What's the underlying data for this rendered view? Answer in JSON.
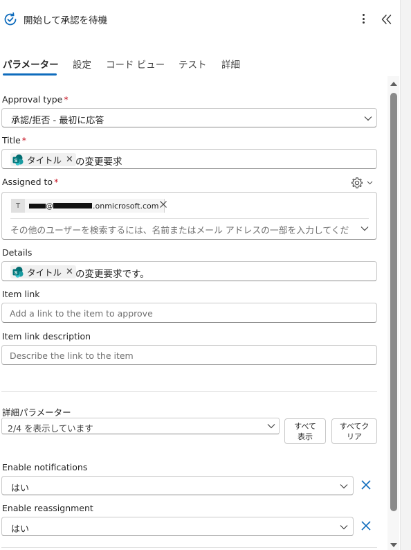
{
  "header": {
    "title": "開始して承認を待機",
    "icon": "approval-refresh-icon",
    "accent": "#0f6cbd"
  },
  "tabs": [
    {
      "label": "パラメーター",
      "active": true
    },
    {
      "label": "設定",
      "active": false
    },
    {
      "label": "コード ビュー",
      "active": false
    },
    {
      "label": "テスト",
      "active": false
    },
    {
      "label": "詳細",
      "active": false
    }
  ],
  "fields": {
    "approval_type": {
      "label": "Approval type",
      "required": "*",
      "value": "承認/拒否 - 最初に応答"
    },
    "title": {
      "label": "Title",
      "required": "*",
      "token": "タイトル",
      "token_close": "✕",
      "suffix": "の変更要求"
    },
    "assigned_to": {
      "label": "Assigned to",
      "required": "*",
      "avatar_initial": "T",
      "email_at": "@",
      "email_domain": ".onmicrosoft.com",
      "placeholder": "その他のユーザーを検索するには、名前またはメール アドレスの一部を入力してくだ"
    },
    "details": {
      "label": "Details",
      "token": "タイトル",
      "token_close": "✕",
      "suffix": "の変更要求です。"
    },
    "item_link": {
      "label": "Item link",
      "placeholder": "Add a link to the item to approve"
    },
    "item_link_description": {
      "label": "Item link description",
      "placeholder": "Describe the link to the item"
    }
  },
  "advanced": {
    "label": "詳細パラメーター",
    "dropdown_value": "2/4 を表示しています",
    "show_all_line1": "すべて",
    "show_all_line2": "表示",
    "clear_all_line1": "すべてク",
    "clear_all_line2": "リア"
  },
  "enable_notifications": {
    "label": "Enable notifications",
    "value": "はい"
  },
  "enable_reassignment": {
    "label": "Enable reassignment",
    "value": "はい"
  },
  "colors": {
    "required": "#c50f1f",
    "accent": "#0f6cbd",
    "sharepoint": "#038387"
  }
}
